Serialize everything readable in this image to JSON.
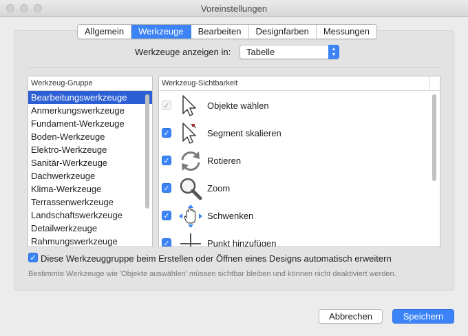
{
  "window": {
    "title": "Voreinstellungen"
  },
  "tabs": [
    {
      "label": "Allgemein",
      "active": false
    },
    {
      "label": "Werkzeuge",
      "active": true
    },
    {
      "label": "Bearbeiten",
      "active": false
    },
    {
      "label": "Designfarben",
      "active": false
    },
    {
      "label": "Messungen",
      "active": false
    }
  ],
  "show_in": {
    "label": "Werkzeuge anzeigen in:",
    "value": "Tabelle"
  },
  "groups": {
    "header": "Werkzeug-Gruppe",
    "selected_index": 0,
    "items": [
      "Bearbeitungswerkzeuge",
      "Anmerkungswerkzeuge",
      "Fundament-Werkzeuge",
      "Boden-Werkzeuge",
      "Elektro-Werkzeuge",
      "Sanitär-Werkzeuge",
      "Dachwerkzeuge",
      "Klima-Werkzeuge",
      "Terrassenwerkzeuge",
      "Landschaftswerkzeuge",
      "Detailwerkzeuge",
      "Rahmungswerkzeuge"
    ]
  },
  "visibility": {
    "header": "Werkzeug-Sichtbarkeit",
    "tools": [
      {
        "label": "Objekte wählen",
        "checked": true,
        "disabled": true,
        "icon": "arrow-cursor-icon"
      },
      {
        "label": "Segment skalieren",
        "checked": true,
        "disabled": false,
        "icon": "scale-segment-icon"
      },
      {
        "label": "Rotieren",
        "checked": true,
        "disabled": false,
        "icon": "rotate-icon"
      },
      {
        "label": "Zoom",
        "checked": true,
        "disabled": false,
        "icon": "magnifier-icon"
      },
      {
        "label": "Schwenken",
        "checked": true,
        "disabled": false,
        "icon": "pan-hand-icon"
      },
      {
        "label": "Punkt hinzufügen",
        "checked": true,
        "disabled": false,
        "icon": "add-point-icon"
      }
    ]
  },
  "auto_expand": {
    "label": "Diese Werkzeuggruppe beim Erstellen oder Öffnen eines Designs automatisch erweitern",
    "checked": true
  },
  "note": "Bestimmte Werkzeuge wie 'Objekte auswählen' müssen sichtbar bleiben und können nicht deaktiviert werden.",
  "buttons": {
    "cancel": "Abbrechen",
    "save": "Speichern"
  },
  "colors": {
    "accent": "#3b83f6",
    "selection": "#2c5fd4"
  }
}
